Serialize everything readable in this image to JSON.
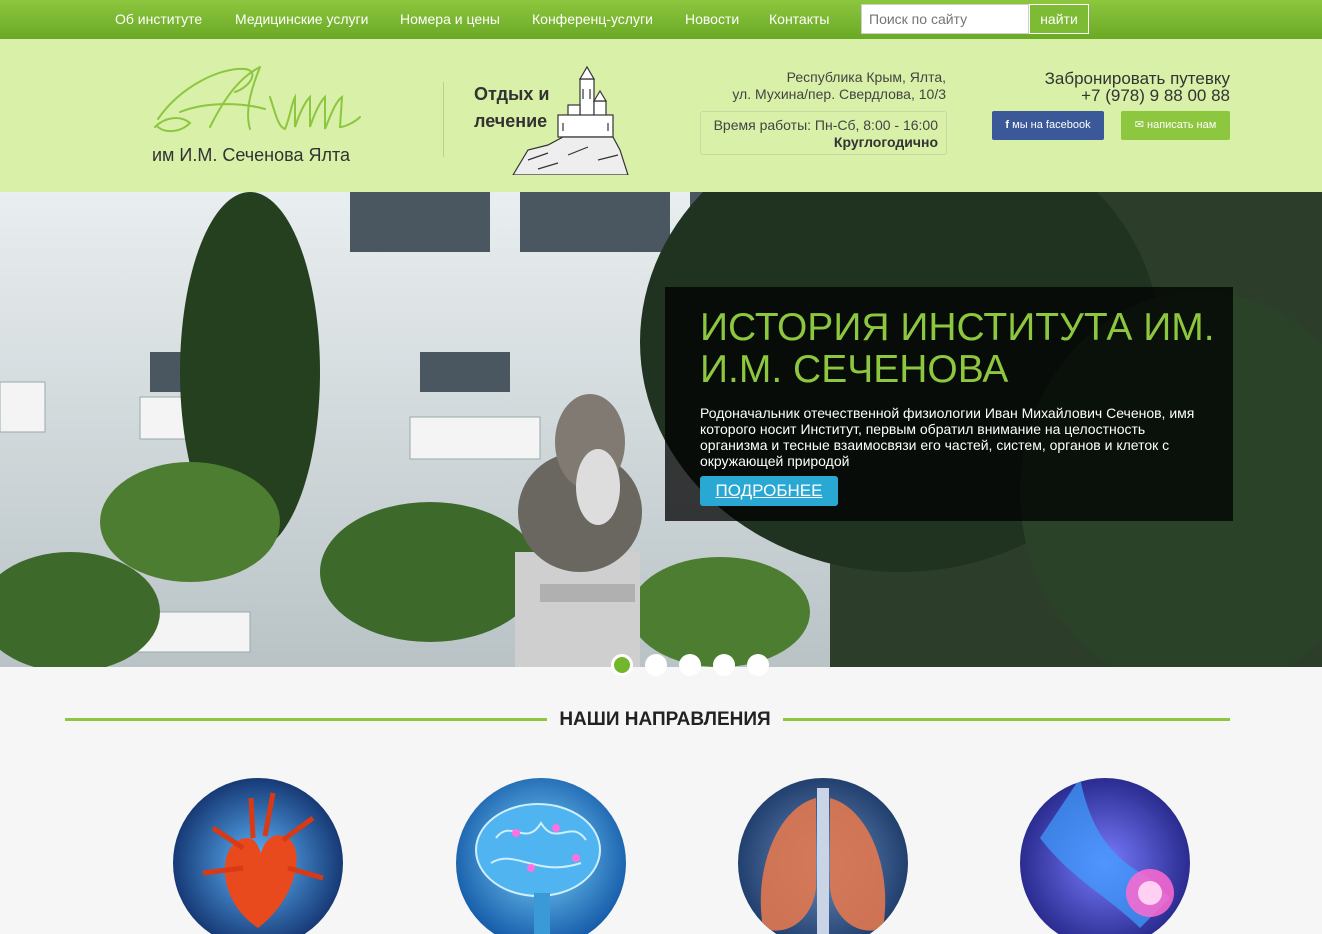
{
  "nav": {
    "items": [
      "Об институте",
      "Медицинские услуги",
      "Номера и цены",
      "Конференц-услуги",
      "Новости",
      "Контакты"
    ],
    "search_placeholder": "Поиск по сайту",
    "search_button": "найти"
  },
  "header": {
    "logo_subtitle": "им И.М. Сеченова Ялта",
    "rest_label": "Отдых и лечение",
    "address_line1": "Республика Крым, Ялта,",
    "address_line2": "ул. Мухина/пер. Свердлова, 10/3",
    "hours": "Время работы: Пн-Сб, 8:00 - 16:00",
    "hours_note": "Круглогодично",
    "book_label": "Забронировать путевку",
    "phone": "+7 (978) 9 88 00 88",
    "facebook_label": "мы на facebook",
    "write_label": "написать нам"
  },
  "hero": {
    "title": "История института им. И.М. Сеченова",
    "text": "Родоначальник отечественной физиологии Иван Михайлович Сеченов, имя которого носит Институт, первым обратил внимание на целостность организма и тесные взаимосвязи его частей, систем, органов и клеток с окружающей природой",
    "button": "ПОДРОБНЕЕ",
    "active_slide": 1,
    "slide_count": 5
  },
  "directions": {
    "title": "НАШИ НАПРАВЛЕНИЯ",
    "items": [
      "heart-image",
      "brain-image",
      "lungs-image",
      "joints-image"
    ]
  },
  "colors": {
    "accent": "#8dc63f",
    "header_bg": "#d8f0a8",
    "facebook": "#3b5998",
    "button_blue": "#29a8d4"
  }
}
